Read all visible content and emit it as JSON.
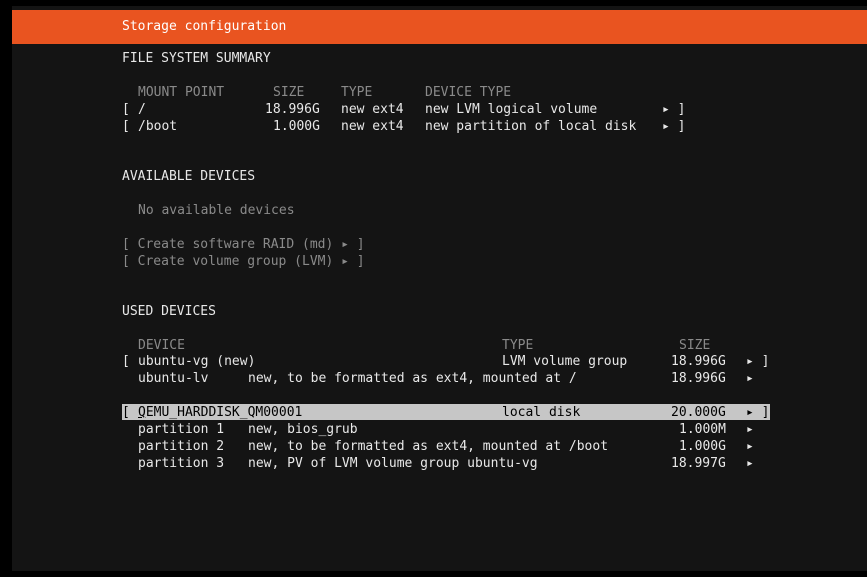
{
  "header": {
    "title": "Storage configuration"
  },
  "fs_summary": {
    "heading": "FILE SYSTEM SUMMARY",
    "columns": [
      "MOUNT POINT",
      "SIZE",
      "TYPE",
      "DEVICE TYPE"
    ],
    "rows": [
      {
        "open": "[",
        "mount": "/",
        "size": "18.996G",
        "type": "new ext4",
        "device_type": "new LVM logical volume",
        "arrow": "▸ ]"
      },
      {
        "open": "[",
        "mount": "/boot",
        "size": "1.000G",
        "type": "new ext4",
        "device_type": "new partition of local disk",
        "arrow": "▸ ]"
      }
    ]
  },
  "available": {
    "heading": "AVAILABLE DEVICES",
    "empty_text": "No available devices",
    "actions": [
      "[ Create software RAID (md) ▸ ]",
      "[ Create volume group (LVM) ▸ ]"
    ]
  },
  "used": {
    "heading": "USED DEVICES",
    "columns": [
      "DEVICE",
      "TYPE",
      "SIZE"
    ],
    "vg": {
      "open": "[",
      "name": "ubuntu-vg (new)",
      "type": "LVM volume group",
      "size": "18.996G",
      "arrow": "▸ ]",
      "lv": {
        "name": "ubuntu-lv",
        "desc": "new, to be formatted as ext4, mounted at /",
        "size": "18.996G",
        "arrow": "▸"
      }
    },
    "disk": {
      "open": "[",
      "name_first": "Q",
      "name_rest": "EMU_HARDDISK_QM00001",
      "type": "local disk",
      "size": "20.000G",
      "arrow": "▸ ]",
      "partitions": [
        {
          "name": "partition 1",
          "desc": "new, bios_grub",
          "size": "1.000M",
          "arrow": "▸"
        },
        {
          "name": "partition 2",
          "desc": "new, to be formatted as ext4, mounted at /boot",
          "size": "1.000G",
          "arrow": "▸"
        },
        {
          "name": "partition 3",
          "desc": "new, PV of LVM volume group ubuntu-vg",
          "size": "18.997G",
          "arrow": "▸"
        }
      ]
    }
  }
}
